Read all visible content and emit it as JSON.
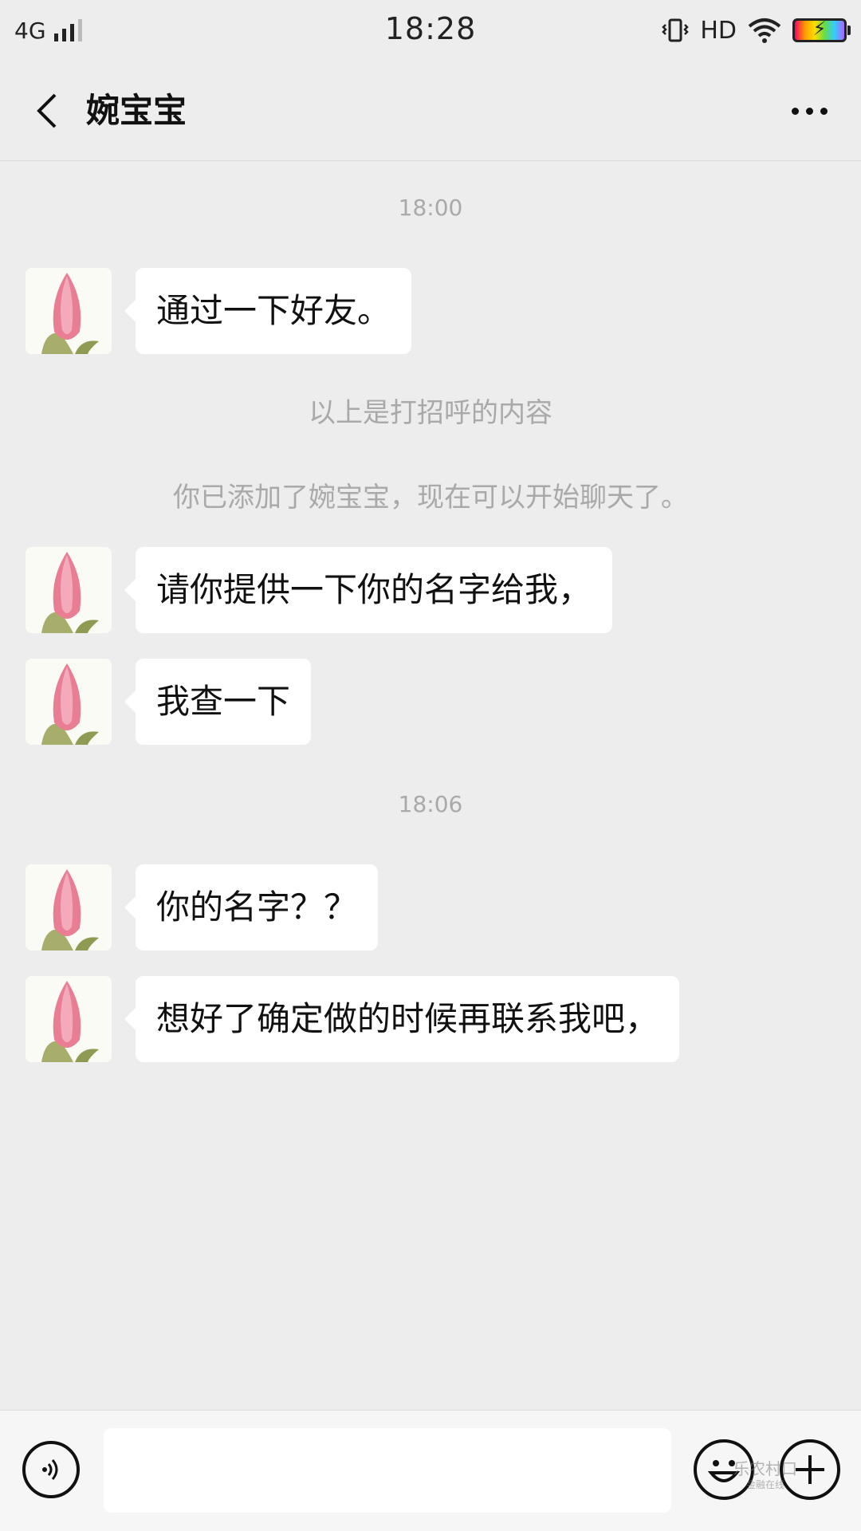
{
  "status_bar": {
    "network": "4G",
    "time": "18:28",
    "hd": "HD",
    "icons": [
      "signal-icon",
      "vibrate-icon",
      "wifi-icon",
      "battery-icon"
    ]
  },
  "header": {
    "title": "婉宝宝",
    "back_icon": "chevron-left-icon",
    "more_icon": "more-dots-icon"
  },
  "chat": {
    "timestamps": [
      "18:00",
      "18:06"
    ],
    "system_messages": [
      "以上是打招呼的内容",
      "你已添加了婉宝宝，现在可以开始聊天了。"
    ],
    "messages": [
      {
        "sender": "婉宝宝",
        "text": "通过一下好友。"
      },
      {
        "sender": "婉宝宝",
        "text": "请你提供一下你的名字给我，"
      },
      {
        "sender": "婉宝宝",
        "text": "我查一下"
      },
      {
        "sender": "婉宝宝",
        "text": "你的名字？？"
      },
      {
        "sender": "婉宝宝",
        "text": "想好了确定做的时候再联系我吧，"
      }
    ]
  },
  "input_bar": {
    "voice_icon": "voice-icon",
    "input_value": "",
    "emoji_icon": "emoji-icon",
    "plus_icon": "plus-icon"
  },
  "watermark": {
    "text": "乐农村口",
    "sub": "金融在线"
  },
  "colors": {
    "background": "#ededed",
    "bubble": "#ffffff",
    "system_text": "#a9a9a9"
  }
}
